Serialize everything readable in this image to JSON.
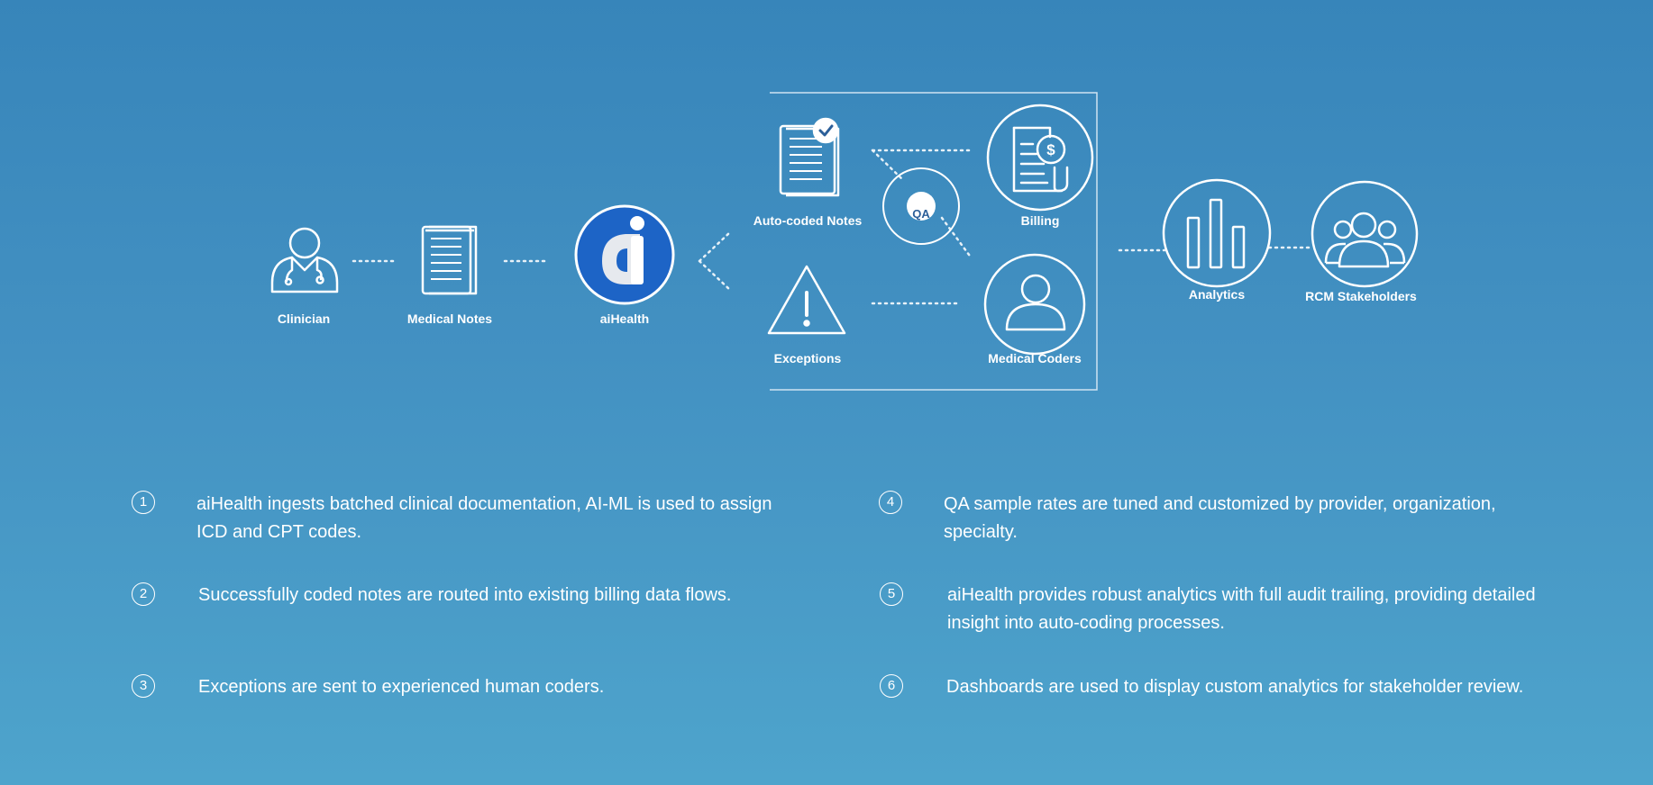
{
  "diagram": {
    "nodes": {
      "clinician": "Clinician",
      "medical_notes": "Medical Notes",
      "aihealth": "aiHealth",
      "auto_coded_notes": "Auto-coded Notes",
      "qa": "QA",
      "billing": "Billing",
      "exceptions": "Exceptions",
      "medical_coders": "Medical Coders",
      "analytics": "Analytics",
      "rcm_stakeholders": "RCM Stakeholders"
    },
    "icons": {
      "clinician": "doctor-icon",
      "medical_notes": "document-stack-icon",
      "aihealth": "aihealth-logo",
      "auto_coded_notes": "checked-document-icon",
      "billing": "invoice-dollar-icon",
      "exceptions": "warning-icon",
      "medical_coders": "person-icon",
      "analytics": "bar-chart-icon",
      "rcm_stakeholders": "group-icon"
    },
    "colors": {
      "logo_blue": "#1d64c6",
      "qa_text": "#2c5f99"
    }
  },
  "steps": [
    {
      "number": "1",
      "text": "aiHealth ingests batched clinical documentation, AI-ML is used to assign ICD and CPT codes."
    },
    {
      "number": "2",
      "text": "Successfully coded notes are routed into existing billing data flows."
    },
    {
      "number": "3",
      "text": "Exceptions are sent to experienced human coders."
    },
    {
      "number": "4",
      "text": "QA sample rates are tuned and customized by provider, organization, specialty."
    },
    {
      "number": "5",
      "text": "aiHealth provides robust analytics with full audit trailing, providing detailed insight into auto-coding processes."
    },
    {
      "number": "6",
      "text": "Dashboards are used to display custom analytics for stakeholder review."
    }
  ]
}
